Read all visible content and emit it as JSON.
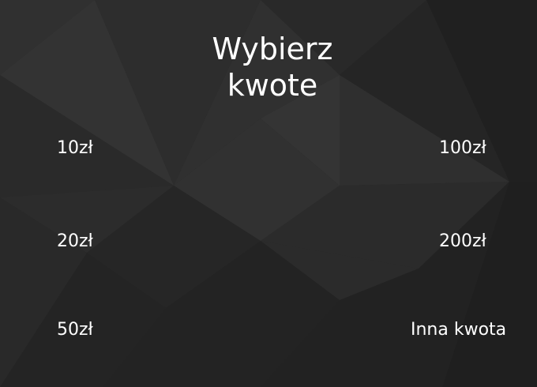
{
  "screen": {
    "title_line1": "Wybierz",
    "title_line2": "kwote"
  },
  "amounts": {
    "left": [
      "10zł",
      "20zł",
      "50zł"
    ],
    "right": [
      "100zł",
      "200zł",
      "Inna kwota"
    ]
  },
  "colors": {
    "background": "#2a2a2a",
    "text": "#ffffff"
  }
}
